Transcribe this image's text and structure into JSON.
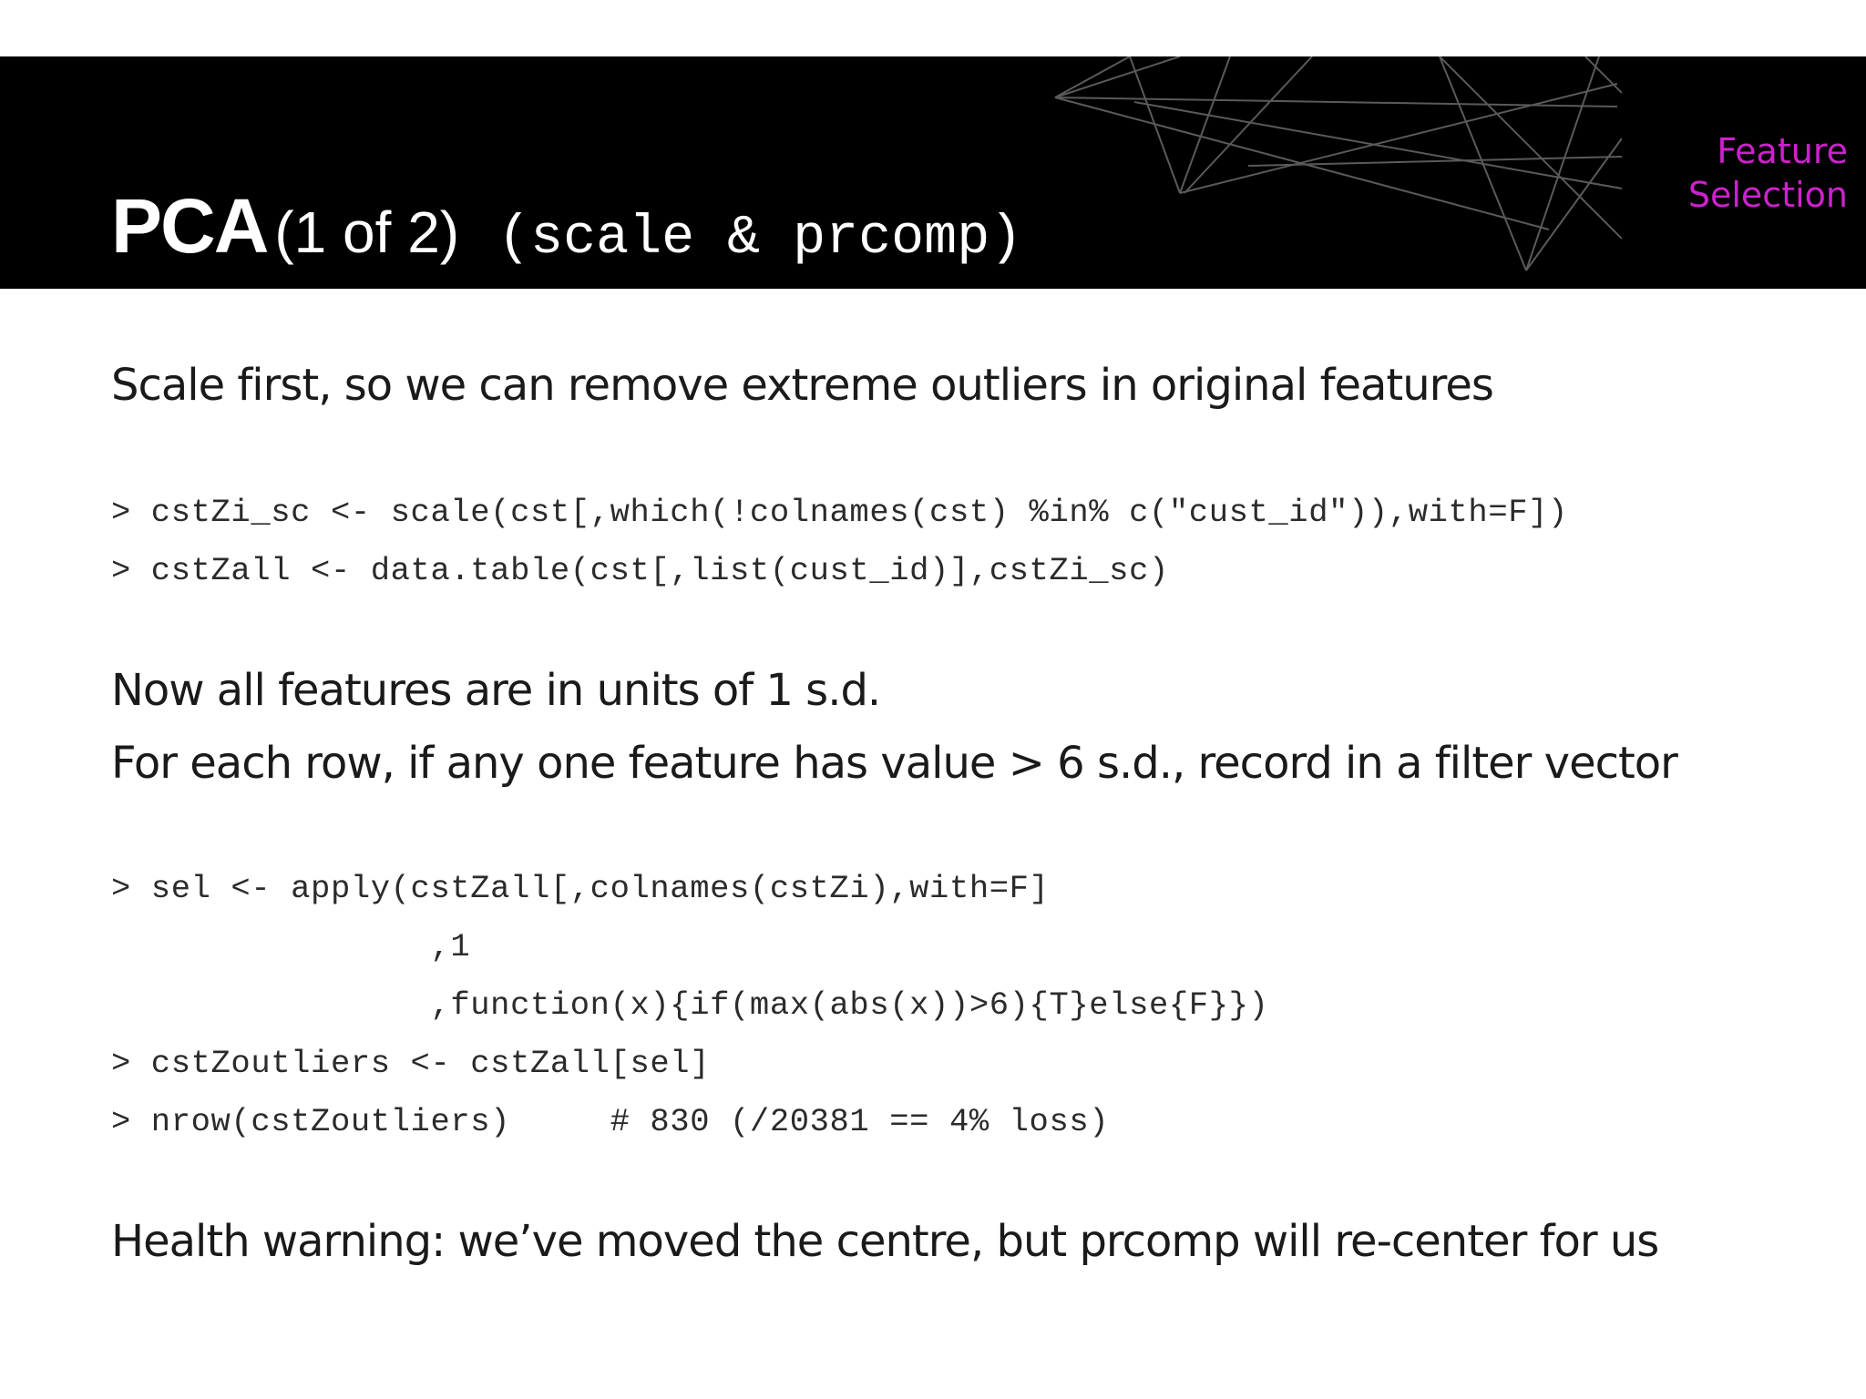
{
  "slide": {
    "title_main": "PCA",
    "title_count": "(1 of 2)",
    "title_code": "(scale & prcomp)",
    "section_line1": "Feature",
    "section_line2": "Selection",
    "accent_color": "#cc22cc",
    "header_color": "#000000"
  },
  "body": {
    "para1": "Scale first, so we can remove extreme outliers in original features",
    "code1_line1": "> cstZi_sc <- scale(cst[,which(!colnames(cst) %in% c(\"cust_id\")),with=F])",
    "code1_line2": "> cstZall <- data.table(cst[,list(cust_id)],cstZi_sc)",
    "para2": "Now all features are in units of 1 s.d.",
    "para3": "For each row, if any one feature has value > 6 s.d., record in a filter vector",
    "code2_line1": "> sel <- apply(cstZall[,colnames(cstZi),with=F]",
    "code2_line2": "                ,1",
    "code2_line3": "                ,function(x){if(max(abs(x))>6){T}else{F}})",
    "code2_line4": "> cstZoutliers <- cstZall[sel]",
    "code2_line5": "> nrow(cstZoutliers)     # 830 (/20381 == 4% loss)",
    "para4": "Health warning: we’ve moved the centre, but prcomp will re-center for us"
  }
}
